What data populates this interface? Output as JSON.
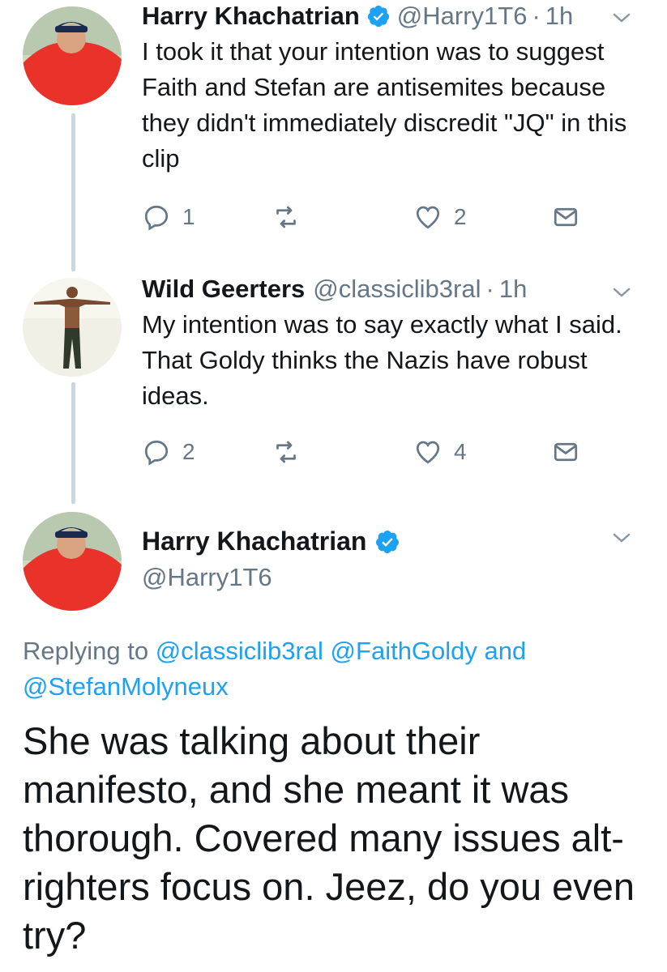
{
  "tweets": [
    {
      "name": "Harry Khachatrian",
      "handle": "@Harry1T6",
      "sep": "·",
      "time": "1h",
      "verified": true,
      "text": "I took it that your intention was to suggest Faith and Stefan are antisemites because they didn't immediately discredit \"JQ\" in this clip",
      "reply_count": "1",
      "like_count": "2"
    },
    {
      "name": "Wild Geerters",
      "handle": "@classiclib3ral",
      "sep": "·",
      "time": "1h",
      "verified": false,
      "text": "My intention was to say exactly what I said. That Goldy thinks the Nazis have robust ideas.",
      "reply_count": "2",
      "like_count": "4"
    }
  ],
  "main_tweet": {
    "name": "Harry Khachatrian",
    "handle": "@Harry1T6",
    "verified": true,
    "replying_prefix": "Replying to",
    "replying_user1": "@classiclib3ral",
    "replying_user2": "@FaithGoldy",
    "replying_and": "and",
    "replying_user3": "@StefanMolyneux",
    "text": "She was talking about their manifesto, and she meant it was thorough. Covered many issues alt-righters focus on. Jeez, do you even try?"
  },
  "colors": {
    "text": "#14171a",
    "secondary": "#657786",
    "link": "#1da1f2",
    "verified": "#1da1f2",
    "thread_line": "#ccd6dd"
  },
  "icons": {
    "reply": "reply-icon",
    "retweet": "retweet-icon",
    "like": "heart-icon",
    "dm": "envelope-icon",
    "menu": "chevron-down-icon",
    "verified": "verified-badge-icon"
  }
}
